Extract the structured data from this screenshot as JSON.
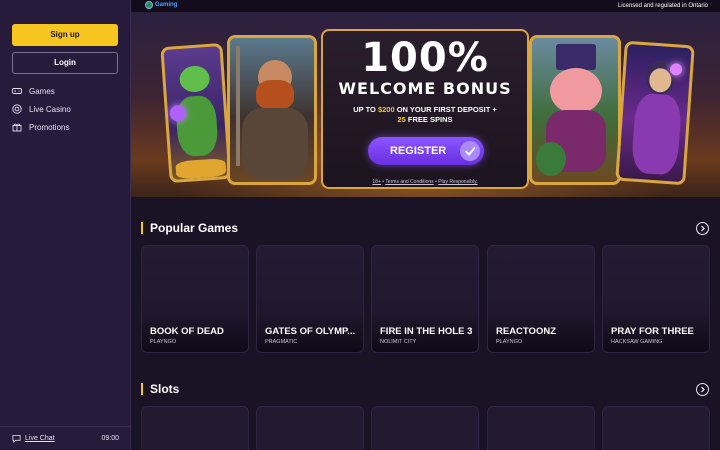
{
  "sidebar": {
    "signup_label": "Sign up",
    "login_label": "Login",
    "nav": [
      {
        "label": "Games",
        "icon": "gamepad-icon"
      },
      {
        "label": "Live Casino",
        "icon": "chip-icon"
      },
      {
        "label": "Promotions",
        "icon": "gift-icon"
      }
    ],
    "live_chat_label": "Live Chat",
    "time": "09:00"
  },
  "topbar": {
    "logo_text": "Gaming",
    "licensed_text": "Licensed and regulated in Ontario"
  },
  "hero": {
    "headline": "100%",
    "subheadline": "WELCOME BONUS",
    "detail_prefix": "UP TO ",
    "detail_amount": "$200",
    "detail_middle": " ON YOUR FIRST DEPOSIT +",
    "detail_spins_count": "25",
    "detail_spins": " FREE SPINS",
    "register_label": "REGISTER",
    "terms_age": "18+",
    "terms_sep": " • ",
    "terms_link": "Terms and Conditions",
    "terms_play": "Play Responsibly."
  },
  "popular": {
    "title": "Popular Games",
    "games": [
      {
        "name": "BOOK OF DEAD",
        "provider": "PLAYNGO"
      },
      {
        "name": "GATES OF OLYMP...",
        "provider": "PRAGMATIC"
      },
      {
        "name": "FIRE IN THE HOLE 3",
        "provider": "NOLIMIT CITY"
      },
      {
        "name": "REACTOONZ",
        "provider": "PLAYNGO"
      },
      {
        "name": "PRAY FOR THREE",
        "provider": "HACKSAW GAMING"
      }
    ]
  },
  "slots": {
    "title": "Slots"
  },
  "colors": {
    "accent": "#f7c520",
    "register": "#7a44f0",
    "background": "#1a1326",
    "sidebar": "#261b3a"
  }
}
